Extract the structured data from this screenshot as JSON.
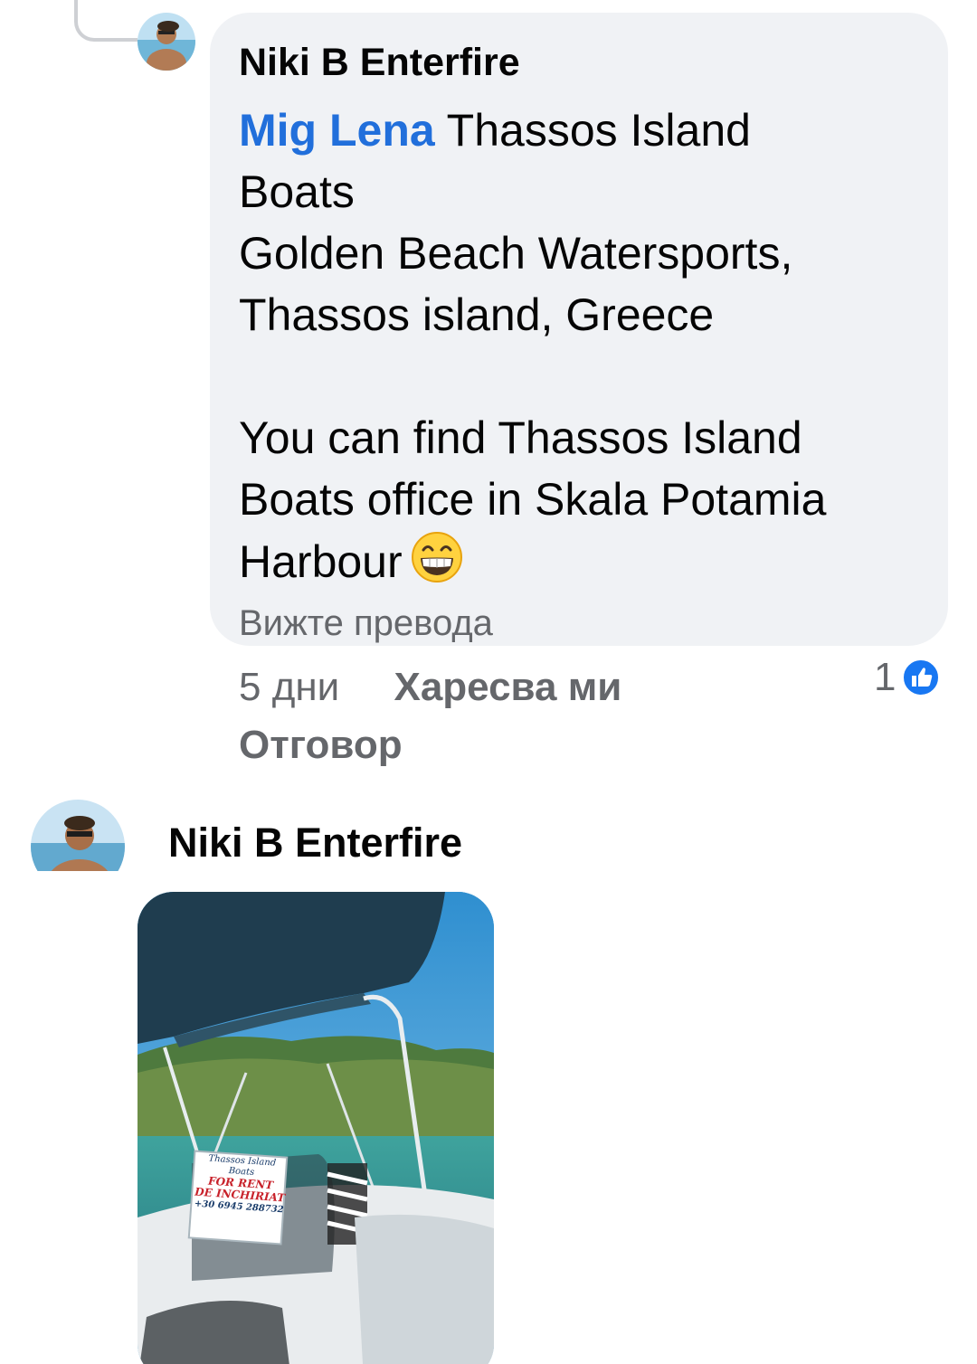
{
  "colors": {
    "bubble_background": "#f0f2f5",
    "mention": "#216fdb",
    "secondary_text": "#65676b",
    "like_badge": "#1877f2"
  },
  "comment": {
    "author": "Niki B Enterfire",
    "mention": "Mig Lena",
    "text": " Thassos Island\nBoats\nGolden Beach Watersports,\nThassos island, Greece\n\nYou can find Thassos Island\nBoats office in Skala Potamia\nHarbour",
    "emoji": "grinning-face-with-smiling-eyes",
    "see_translation": "Вижте превода",
    "time": "5 дни",
    "like_label": "Харесва ми",
    "reply_label": "Отговор",
    "reaction_count": "1",
    "reaction_icon": "like-icon"
  },
  "second_comment": {
    "author": "Niki B Enterfire",
    "photo": {
      "sign_title_1": "Thassos Island",
      "sign_title_2": "Boats",
      "sign_for_rent": "FOR RENT",
      "sign_de_inchiriat": "DE INCHIRIAT",
      "sign_phone": "+30 6945 288732"
    }
  }
}
